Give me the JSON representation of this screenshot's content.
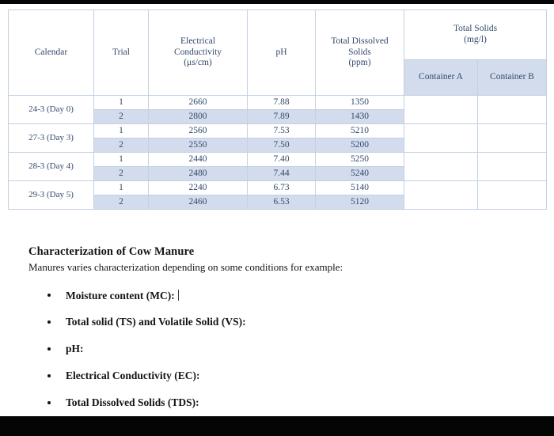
{
  "document": {
    "table": {
      "headers": {
        "calendar": "Calendar",
        "trial": "Trial",
        "electrical_conductivity": "Electrical Conductivity (μs/cm)",
        "electrical_conductivity_line1": "Electrical",
        "electrical_conductivity_line2": "Conductivity",
        "electrical_conductivity_line3": "(μs/cm)",
        "ph": "pH",
        "total_dissolved_solids_line1": "Total Dissolved",
        "total_dissolved_solids_line2": "Solids",
        "total_dissolved_solids_line3": "(ppm)",
        "total_solids_line1": "Total Solids",
        "total_solids_line2": "(mg/l)",
        "container_a": "Container A",
        "container_b": "Container B"
      },
      "rows": [
        {
          "calendar": "24-3 (Day 0)",
          "trials": [
            {
              "trial": "1",
              "ec": "2660",
              "ph": "7.88",
              "tds": "1350",
              "container_a": "",
              "container_b": ""
            },
            {
              "trial": "2",
              "ec": "2800",
              "ph": "7.89",
              "tds": "1430",
              "container_a": "",
              "container_b": ""
            }
          ]
        },
        {
          "calendar": "27-3 (Day 3)",
          "trials": [
            {
              "trial": "1",
              "ec": "2560",
              "ph": "7.53",
              "tds": "5210",
              "container_a": "",
              "container_b": ""
            },
            {
              "trial": "2",
              "ec": "2550",
              "ph": "7.50",
              "tds": "5200",
              "container_a": "",
              "container_b": ""
            }
          ]
        },
        {
          "calendar": "28-3 (Day 4)",
          "trials": [
            {
              "trial": "1",
              "ec": "2440",
              "ph": "7.40",
              "tds": "5250",
              "container_a": "",
              "container_b": ""
            },
            {
              "trial": "2",
              "ec": "2480",
              "ph": "7.44",
              "tds": "5240",
              "container_a": "",
              "container_b": ""
            }
          ]
        },
        {
          "calendar": "29-3 (Day 5)",
          "trials": [
            {
              "trial": "1",
              "ec": "2240",
              "ph": "6.73",
              "tds": "5140",
              "container_a": "",
              "container_b": ""
            },
            {
              "trial": "2",
              "ec": "2460",
              "ph": "6.53",
              "tds": "5120",
              "container_a": "",
              "container_b": ""
            }
          ]
        }
      ]
    },
    "section": {
      "title": "Characterization of Cow Manure",
      "intro": "Manures varies characterization depending on some conditions for example:",
      "bullets": [
        {
          "label": "Moisture content (MC):",
          "has_caret": true
        },
        {
          "label": "Total solid (TS) and Volatile Solid (VS):",
          "has_caret": false
        },
        {
          "label": "pH:",
          "has_caret": false
        },
        {
          "label": "Electrical Conductivity (EC):",
          "has_caret": false
        },
        {
          "label": "Total Dissolved Solids (TDS):",
          "has_caret": false
        }
      ]
    }
  },
  "colors": {
    "table_text": "#32496b",
    "table_border": "#c3d0e4",
    "row_shade": "#d3dcec",
    "body_text": "#141414",
    "scan_bar": "#050505"
  }
}
